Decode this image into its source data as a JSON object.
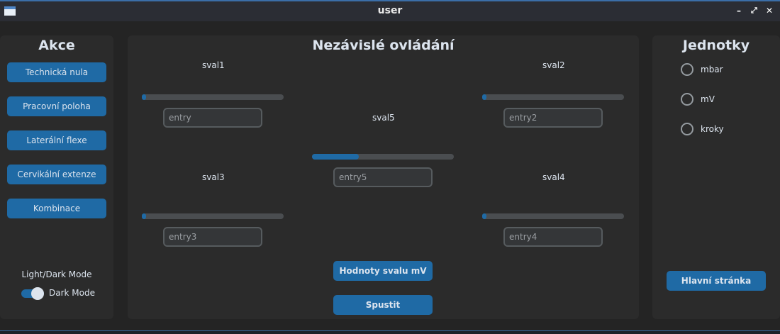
{
  "window": {
    "title": "user"
  },
  "left": {
    "heading": "Akce",
    "buttons": [
      "Technická nula",
      "Pracovní poloha",
      "Laterální flexe",
      "Cervikální extenze",
      "Kombinace"
    ],
    "mode_label": "Light/Dark Mode",
    "switch_label": "Dark Mode",
    "switch_on": true
  },
  "middle": {
    "heading": "Nezávislé ovládání",
    "muscles": [
      {
        "label": "sval1",
        "placeholder": "entry",
        "value": 0.03
      },
      {
        "label": "sval2",
        "placeholder": "entry2",
        "value": 0.03
      },
      {
        "label": "sval3",
        "placeholder": "entry3",
        "value": 0.03
      },
      {
        "label": "sval4",
        "placeholder": "entry4",
        "value": 0.03
      },
      {
        "label": "sval5",
        "placeholder": "entry5",
        "value": 0.33
      }
    ],
    "values_button": "Hodnoty svalu mV",
    "run_button": "Spustit"
  },
  "right": {
    "heading": "Jednotky",
    "units": [
      "mbar",
      "mV",
      "kroky"
    ],
    "main_button": "Hlavní stránka"
  },
  "colors": {
    "accent": "#1f6aa5",
    "panel": "#2b2b2b",
    "background": "#242424"
  }
}
